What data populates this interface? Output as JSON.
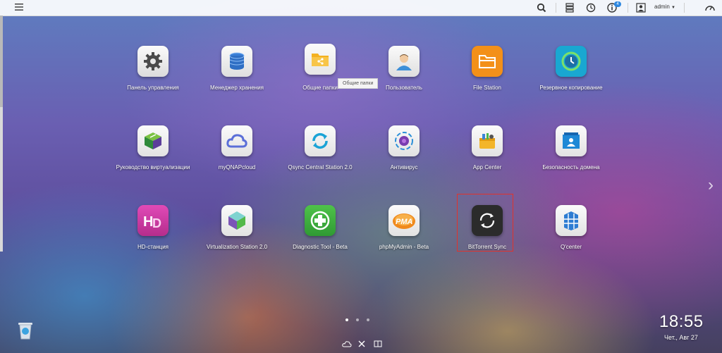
{
  "topbar": {
    "user": "admin",
    "notification_count": "4"
  },
  "apps": [
    {
      "label": "Панель управления"
    },
    {
      "label": "Менеджер хранения"
    },
    {
      "label": "Общие папки"
    },
    {
      "label": "Пользователь"
    },
    {
      "label": "File Station"
    },
    {
      "label": "Резервное копирование"
    },
    {
      "label": "Руководство виртуализации"
    },
    {
      "label": "myQNAPcloud"
    },
    {
      "label": "Qsync Central Station 2.0"
    },
    {
      "label": "Антивирус"
    },
    {
      "label": "App Center"
    },
    {
      "label": "Безопасность домена"
    },
    {
      "label": "HD-станция"
    },
    {
      "label": "Virtualization Station 2.0"
    },
    {
      "label": "Diagnostic Tool - Beta"
    },
    {
      "label": "phpMyAdmin - Beta"
    },
    {
      "label": "BitTorrent Sync"
    },
    {
      "label": "Q'center"
    }
  ],
  "tooltip": "Общие папки",
  "clock": {
    "time": "18:55",
    "date": "Чет., Авг 27"
  },
  "icon_names": [
    "menu-icon",
    "search-icon",
    "storage-alert-icon",
    "sync-icon",
    "info-icon",
    "user-icon",
    "dashboard-icon",
    "trash-icon",
    "cloud-icon",
    "tools-icon",
    "book-icon"
  ],
  "colors": {
    "selection_border": "#e0332d",
    "badge": "#2e88e0"
  }
}
